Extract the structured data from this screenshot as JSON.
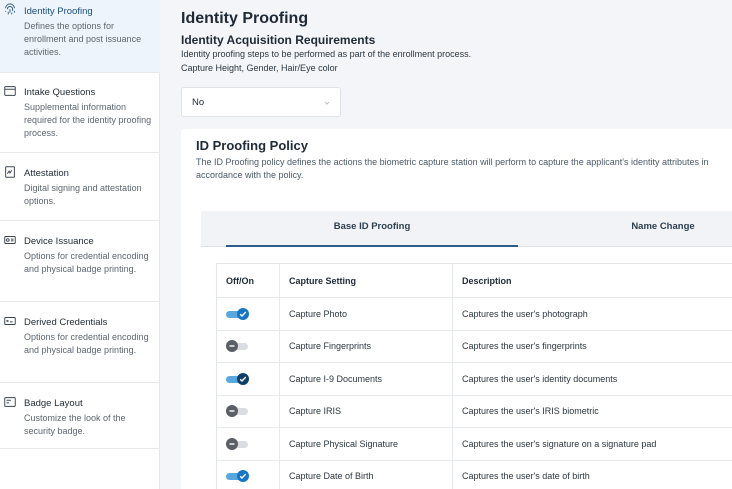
{
  "sidebar": {
    "items": [
      {
        "title": "Identity Proofing",
        "desc": "Defines the options for enrollment and post issuance activities.",
        "icon": "fingerprint-icon",
        "active": true
      },
      {
        "title": "Intake Questions",
        "desc": "Supplemental information required for the identity proofing process.",
        "icon": "envelope-icon"
      },
      {
        "title": "Attestation",
        "desc": "Digital signing and attestation options.",
        "icon": "signature-document-icon"
      },
      {
        "title": "Device Issuance",
        "desc": "Options for credential encoding and physical badge printing.",
        "icon": "id-card-icon"
      },
      {
        "title": "Derived Credentials",
        "desc": "Options for credential encoding and physical badge printing.",
        "icon": "credential-card-icon"
      },
      {
        "title": "Badge Layout",
        "desc": "Customize the look of the security badge.",
        "icon": "badge-icon"
      }
    ]
  },
  "main": {
    "title": "Identity Proofing",
    "acquisition": {
      "title": "Identity Acquisition Requirements",
      "line1": "Identity proofing steps to be performed as part of the enrollment process.",
      "line2": "Capture Height, Gender, Hair/Eye color",
      "select_value": "No"
    },
    "policy": {
      "title": "ID Proofing Policy",
      "desc": "The ID Proofing policy defines the actions the biometric capture station will perform to capture the applicant's identity attributes in accordance with the policy.",
      "tabs": [
        {
          "label": "Base ID Proofing",
          "active": true
        },
        {
          "label": "Name Change",
          "active": false
        }
      ],
      "table": {
        "headers": [
          "Off/On",
          "Capture Setting",
          "Description"
        ],
        "rows": [
          {
            "on": true,
            "setting": "Capture Photo",
            "description": "Captures the user's photograph"
          },
          {
            "on": false,
            "setting": "Capture Fingerprints",
            "description": "Captures the user's fingerprints"
          },
          {
            "on": true,
            "setting": "Capture I-9 Documents",
            "description": "Captures the user's identity documents"
          },
          {
            "on": false,
            "setting": "Capture IRIS",
            "description": "Captures the user's IRIS biometric"
          },
          {
            "on": false,
            "setting": "Capture Physical Signature",
            "description": "Captures the user's signature on a signature pad"
          },
          {
            "on": true,
            "setting": "Capture Date of Birth",
            "description": "Captures the user's date of birth"
          }
        ]
      }
    }
  },
  "colors": {
    "accent": "#1676c2",
    "active_nav_bg": "#eef4fb",
    "tab_underline": "#2f5d8a"
  }
}
